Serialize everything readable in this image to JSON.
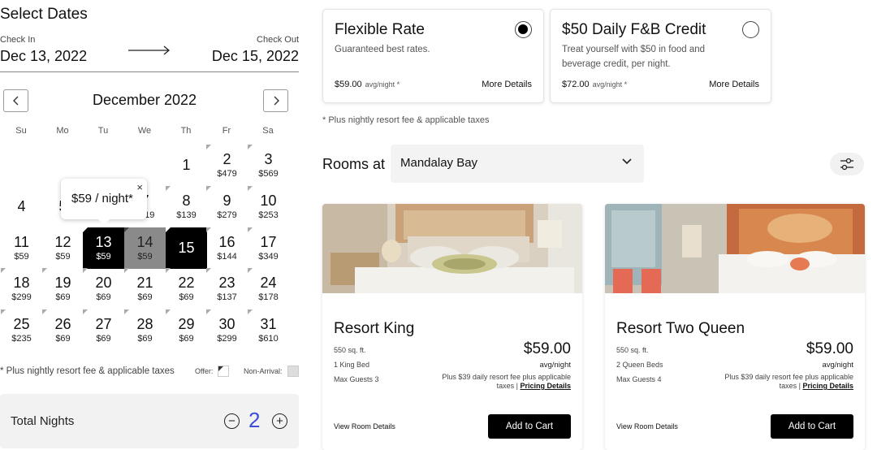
{
  "dates": {
    "title": "Select Dates",
    "check_in_label": "Check In",
    "check_in_value": "Dec 13, 2022",
    "check_out_label": "Check Out",
    "check_out_value": "Dec 15, 2022"
  },
  "calendar": {
    "month": "December 2022",
    "weekdays": [
      "Su",
      "Mo",
      "Tu",
      "We",
      "Th",
      "Fr",
      "Sa"
    ],
    "weeks": [
      [
        null,
        null,
        null,
        null,
        {
          "day": "1",
          "price": ""
        },
        {
          "day": "2",
          "price": "$479"
        },
        {
          "day": "3",
          "price": "$569"
        }
      ],
      [
        {
          "day": "4",
          "price": ""
        },
        {
          "day": "5",
          "price": ""
        },
        {
          "day": "6",
          "price": ""
        },
        {
          "day": "7",
          "price": "$119"
        },
        {
          "day": "8",
          "price": "$139"
        },
        {
          "day": "9",
          "price": "$279"
        },
        {
          "day": "10",
          "price": "$253"
        }
      ],
      [
        {
          "day": "11",
          "price": "$59"
        },
        {
          "day": "12",
          "price": "$59"
        },
        {
          "day": "13",
          "price": "$59"
        },
        {
          "day": "14",
          "price": "$59"
        },
        {
          "day": "15",
          "price": ""
        },
        {
          "day": "16",
          "price": "$144"
        },
        {
          "day": "17",
          "price": "$349"
        }
      ],
      [
        {
          "day": "18",
          "price": "$299"
        },
        {
          "day": "19",
          "price": "$69"
        },
        {
          "day": "20",
          "price": "$69"
        },
        {
          "day": "21",
          "price": "$69"
        },
        {
          "day": "22",
          "price": "$69"
        },
        {
          "day": "23",
          "price": "$137"
        },
        {
          "day": "24",
          "price": "$178"
        }
      ],
      [
        {
          "day": "25",
          "price": "$235"
        },
        {
          "day": "26",
          "price": "$69"
        },
        {
          "day": "27",
          "price": "$69"
        },
        {
          "day": "28",
          "price": "$69"
        },
        {
          "day": "29",
          "price": "$69"
        },
        {
          "day": "30",
          "price": "$299"
        },
        {
          "day": "31",
          "price": "$610"
        }
      ]
    ],
    "tooltip_text": "$59 / night*",
    "tooltip_close": "×",
    "footnote": "* Plus nightly resort fee & applicable taxes",
    "legend_offer": "Offer:",
    "legend_non_arrival": "Non-Arrival:"
  },
  "total_nights": {
    "label": "Total Nights",
    "value": "2",
    "minus": "−",
    "plus": "+"
  },
  "offers": [
    {
      "title": "Flexible Rate",
      "desc": "Guaranteed best rates.",
      "price": "$59.00",
      "unit": "avg/night *",
      "more": "More Details",
      "selected": true
    },
    {
      "title": "$50 Daily F&B Credit",
      "desc": "Treat yourself with $50 in food and beverage credit, per night.",
      "price": "$72.00",
      "unit": "avg/night *",
      "more": "More Details",
      "selected": false
    }
  ],
  "offers_footnote": "* Plus nightly resort fee & applicable taxes",
  "rooms_section": {
    "label": "Rooms at",
    "hotel": "Mandalay Bay"
  },
  "rooms": [
    {
      "name": "Resort King",
      "sqft": "550 sq. ft.",
      "beds": "1 King Bed",
      "guests": "Max Guests 3",
      "price": "$59.00",
      "avg": "avg/night",
      "fee_text": "Plus $39 daily resort fee plus applicable taxes | ",
      "pricing_link": "Pricing Details",
      "view": "View Room Details",
      "cart": "Add to Cart"
    },
    {
      "name": "Resort Two Queen",
      "sqft": "550 sq. ft.",
      "beds": "2 Queen Beds",
      "guests": "Max Guests 4",
      "price": "$59.00",
      "avg": "avg/night",
      "fee_text": "Plus $39 daily resort fee plus applicable taxes | ",
      "pricing_link": "Pricing Details",
      "view": "View Room Details",
      "cart": "Add to Cart"
    }
  ]
}
